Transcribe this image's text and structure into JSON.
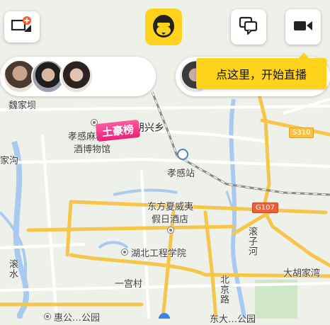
{
  "tooltip": {
    "text": "点这里，开始直播"
  },
  "ranking_badge": {
    "label": "土豪榜"
  },
  "map": {
    "labels": {
      "weijiaxiang": "魏家坝",
      "pengxingxiang": "朋兴乡",
      "xiaogan_museum_l1": "孝感麻糖米",
      "xiaogan_museum_l2": "酒博物馆",
      "jiagou": "家沟",
      "xiaogan_station": "孝感站",
      "hotel_l1": "东方夏威夷",
      "hotel_l2": "假日酒店",
      "hubei_engineering": "湖北工程学院",
      "gunzi_river": "滚子河",
      "gun_shui": "滚水",
      "yigongcun": "一宫村",
      "beijing_road": "北京路",
      "dahujia": "大胡家湾",
      "park_partial": "惠公…公园",
      "park_partial_2": "东大…公园"
    },
    "road_badges": {
      "s310": "S310",
      "g107": "G107"
    },
    "colors": {
      "highway": "#f5c64a",
      "railway": "#8a8a8a",
      "water": "#a9c9ef",
      "land": "#eef0ea",
      "accent": "#ffd21c"
    }
  },
  "icons": {
    "left_button": "screen-add-icon",
    "logo": "bear-logo-icon",
    "chat": "chat-icon",
    "video": "video-camera-icon"
  }
}
